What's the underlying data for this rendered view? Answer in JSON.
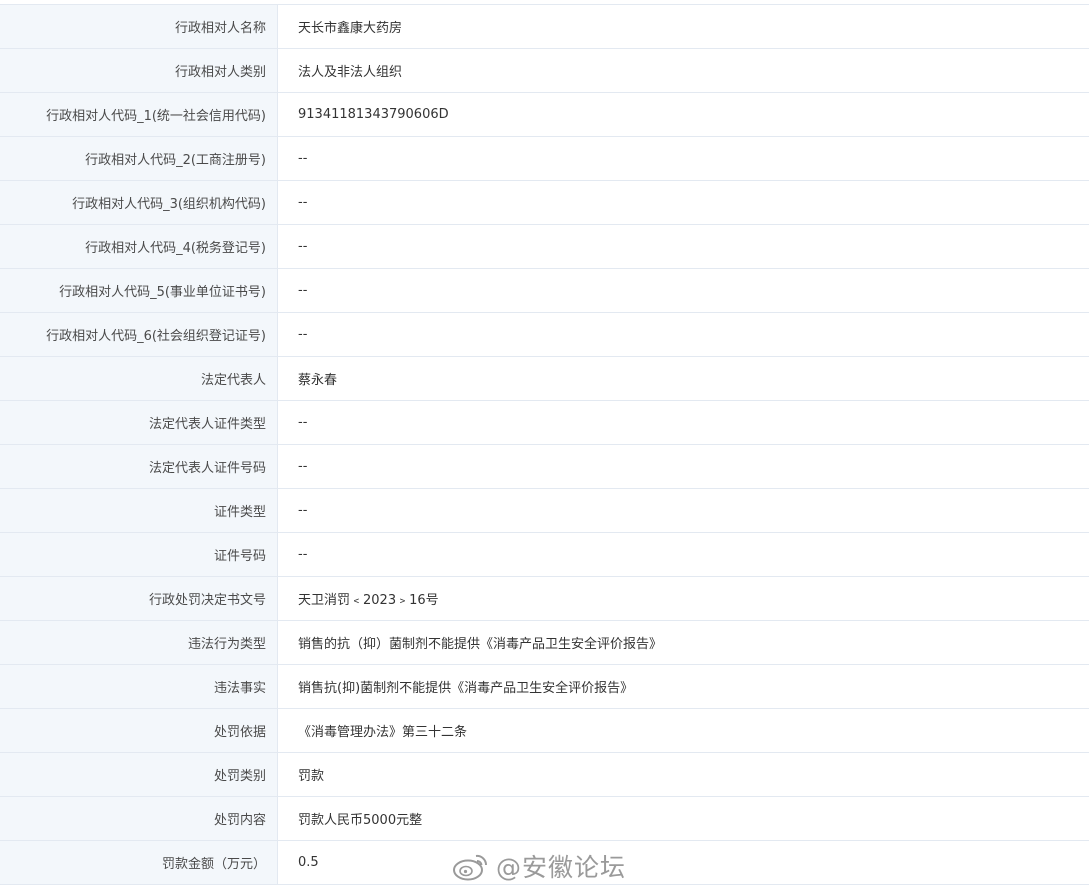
{
  "rows": [
    {
      "label": "行政相对人名称",
      "value": "天长市鑫康大药房"
    },
    {
      "label": "行政相对人类别",
      "value": "法人及非法人组织"
    },
    {
      "label": "行政相对人代码_1(统一社会信用代码)",
      "value": "91341181343790606D"
    },
    {
      "label": "行政相对人代码_2(工商注册号)",
      "value": "--"
    },
    {
      "label": "行政相对人代码_3(组织机构代码)",
      "value": "--"
    },
    {
      "label": "行政相对人代码_4(税务登记号)",
      "value": "--"
    },
    {
      "label": "行政相对人代码_5(事业单位证书号)",
      "value": "--"
    },
    {
      "label": "行政相对人代码_6(社会组织登记证号)",
      "value": "--"
    },
    {
      "label": "法定代表人",
      "value": "蔡永春"
    },
    {
      "label": "法定代表人证件类型",
      "value": "--"
    },
    {
      "label": "法定代表人证件号码",
      "value": "--"
    },
    {
      "label": "证件类型",
      "value": "--"
    },
    {
      "label": "证件号码",
      "value": "--"
    },
    {
      "label": "行政处罚决定书文号",
      "value": "天卫消罚﹤2023﹥16号"
    },
    {
      "label": "违法行为类型",
      "value": "销售的抗（抑）菌制剂不能提供《消毒产品卫生安全评价报告》"
    },
    {
      "label": "违法事实",
      "value": "销售抗(抑)菌制剂不能提供《消毒产品卫生安全评价报告》"
    },
    {
      "label": "处罚依据",
      "value": "《消毒管理办法》第三十二条"
    },
    {
      "label": "处罚类别",
      "value": "罚款"
    },
    {
      "label": "处罚内容",
      "value": "罚款人民币5000元整"
    },
    {
      "label": "罚款金额（万元）",
      "value": "0.5"
    }
  ],
  "watermark": {
    "text": "@安徽论坛",
    "icon": "weibo-logo-icon"
  },
  "colors": {
    "label_bg": "#f3f7fb",
    "border": "#e3e9f1",
    "label_text": "#4a4a4a",
    "value_text": "#333333"
  }
}
